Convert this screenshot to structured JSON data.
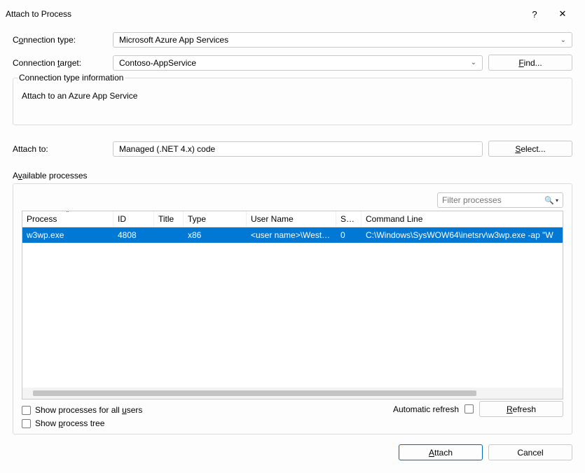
{
  "dialog": {
    "title": "Attach to Process",
    "help_icon": "?",
    "close_icon": "✕"
  },
  "labels": {
    "connection_type_pre": "C",
    "connection_type_u": "o",
    "connection_type_post": "nnection type:",
    "connection_target_pre": "Connection ",
    "connection_target_u": "t",
    "connection_target_post": "arget:",
    "find_pre": "",
    "find_u": "F",
    "find_post": "ind...",
    "info_group": "Connection type information",
    "info_text": "Attach to an Azure App Service",
    "attach_to": "Attach to:",
    "select_pre": "",
    "select_u": "S",
    "select_post": "elect...",
    "available_pre": "A",
    "available_u": "v",
    "available_post": "ailable processes",
    "filter_placeholder": "Filter processes",
    "show_all_pre": "Show processes for all ",
    "show_all_u": "u",
    "show_all_post": "sers",
    "show_tree_pre": "Show ",
    "show_tree_u": "p",
    "show_tree_post": "rocess tree",
    "auto_refresh": "Automatic refresh",
    "refresh_pre": "",
    "refresh_u": "R",
    "refresh_post": "efresh",
    "attach_pre": "",
    "attach_u": "A",
    "attach_post": "ttach",
    "cancel": "Cancel"
  },
  "values": {
    "connection_type": "Microsoft Azure App Services",
    "connection_target": "Contoso-AppService",
    "attach_to": "Managed (.NET 4.x) code"
  },
  "table": {
    "headers": {
      "process": "Process",
      "id": "ID",
      "title": "Title",
      "type": "Type",
      "user": "User Name",
      "session": "Ses...",
      "cmd": "Command Line"
    },
    "rows": [
      {
        "process": "w3wp.exe",
        "id": "4808",
        "title": "",
        "type": "x86",
        "user": "<user name>\\West-...",
        "session": "0",
        "cmd": "C:\\Windows\\SysWOW64\\inetsrv\\w3wp.exe -ap \"W"
      }
    ]
  }
}
